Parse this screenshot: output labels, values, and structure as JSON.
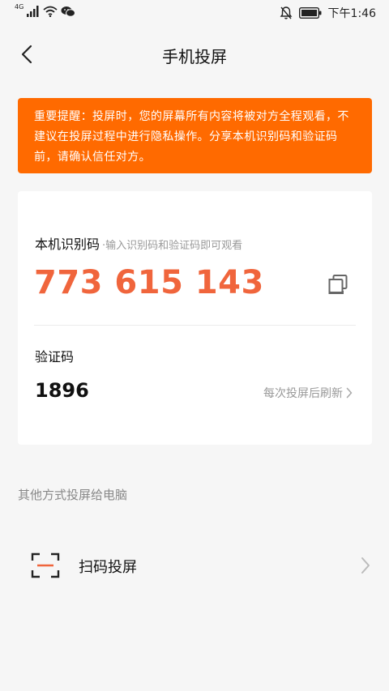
{
  "status_bar": {
    "network_label": "4G",
    "time": "下午1:46",
    "icons": [
      "signal-icon",
      "wifi-icon",
      "wechat-icon",
      "mute-bell-icon",
      "battery-icon"
    ]
  },
  "header": {
    "title": "手机投屏",
    "back_icon": "chevron-left-icon"
  },
  "warning": {
    "text": "重要提醒：投屏时，您的屏幕所有内容将被对方全程观看，不建议在投屏过程中进行隐私操作。分享本机识别码和验证码前，请确认信任对方。",
    "background_color": "#ff6a00"
  },
  "device_id": {
    "label": "本机识别码",
    "hint": "·输入识别码和验证码即可观看",
    "value": "773 615 143",
    "value_color": "#f0653c",
    "copy_icon": "copy-icon"
  },
  "verification": {
    "label": "验证码",
    "value": "1896",
    "refresh_text": "每次投屏后刷新"
  },
  "other_methods": {
    "section_title": "其他方式投屏给电脑",
    "items": [
      {
        "label": "扫码投屏",
        "icon": "scan-icon"
      }
    ]
  }
}
